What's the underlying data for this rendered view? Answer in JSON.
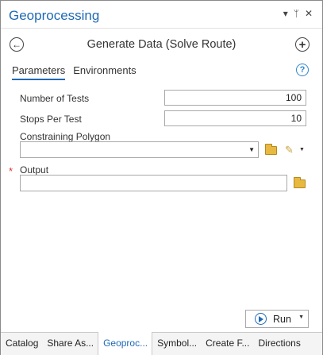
{
  "pane": {
    "title": "Geoprocessing",
    "controls": {
      "menu": "▾",
      "pin": "ᛘ",
      "close": "✕"
    }
  },
  "tool": {
    "title": "Generate Data (Solve Route)",
    "back_icon": "back-arrow-icon",
    "add_icon": "plus-circle-icon"
  },
  "tabs": [
    {
      "label": "Parameters",
      "active": true
    },
    {
      "label": "Environments",
      "active": false
    }
  ],
  "help": {
    "label": "?"
  },
  "params": {
    "number_of_tests": {
      "label": "Number of Tests",
      "value": "100"
    },
    "stops_per_test": {
      "label": "Stops Per Test",
      "value": "10"
    },
    "constraining_polygon": {
      "label": "Constraining Polygon",
      "value": ""
    },
    "output": {
      "label": "Output",
      "value": "",
      "required_mark": "*"
    }
  },
  "run": {
    "label": "Run"
  },
  "bottom_tabs": [
    {
      "label": "Catalog",
      "active": false
    },
    {
      "label": "Share As...",
      "active": false
    },
    {
      "label": "Geoproc...",
      "active": true
    },
    {
      "label": "Symbol...",
      "active": false
    },
    {
      "label": "Create F...",
      "active": false
    },
    {
      "label": "Directions",
      "active": false
    }
  ],
  "colors": {
    "accent": "#1f6ab5",
    "required": "#dd3333",
    "folder": "#e8b940"
  }
}
